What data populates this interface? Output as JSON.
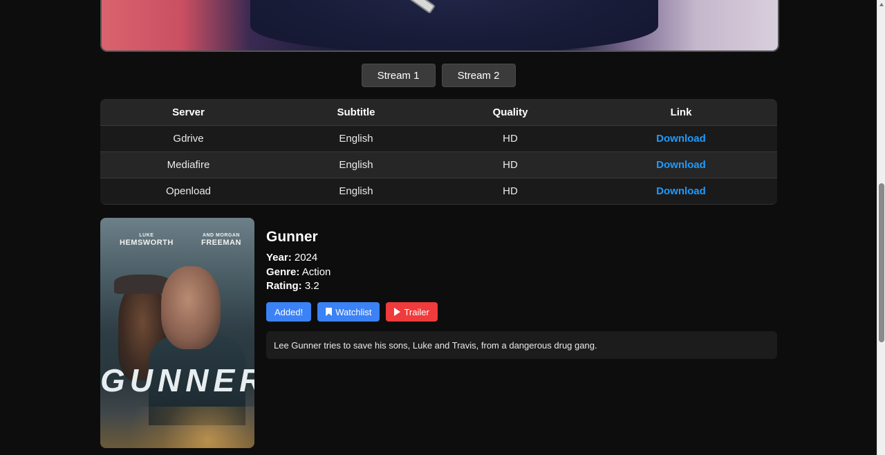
{
  "streams": {
    "buttons": [
      {
        "label": "Stream 1"
      },
      {
        "label": "Stream 2"
      }
    ]
  },
  "table": {
    "headers": {
      "server": "Server",
      "subtitle": "Subtitle",
      "quality": "Quality",
      "link": "Link"
    },
    "rows": [
      {
        "server": "Gdrive",
        "subtitle": "English",
        "quality": "HD",
        "link": "Download"
      },
      {
        "server": "Mediafire",
        "subtitle": "English",
        "quality": "HD",
        "link": "Download"
      },
      {
        "server": "Openload",
        "subtitle": "English",
        "quality": "HD",
        "link": "Download"
      }
    ]
  },
  "movie": {
    "title": "Gunner",
    "year_label": "Year:",
    "year": "2024",
    "genre_label": "Genre:",
    "genre": "Action",
    "rating_label": "Rating:",
    "rating": "3.2",
    "poster": {
      "actor1_first": "LUKE",
      "actor1_last": "HEMSWORTH",
      "actor2_first": "AND MORGAN",
      "actor2_last": "FREEMAN",
      "title": "GUNNER"
    },
    "actions": {
      "added": "Added!",
      "watchlist": "Watchlist",
      "trailer": "Trailer"
    },
    "description": "Lee Gunner tries to save his sons, Luke and Travis, from a dangerous drug gang."
  },
  "colors": {
    "accent_blue": "#3b82f6",
    "link_blue": "#1e9bff",
    "trailer_red": "#ef3b3b",
    "background": "#0d0d0d"
  },
  "icons": {
    "watchlist": "bookmark-icon",
    "trailer": "play-icon"
  }
}
